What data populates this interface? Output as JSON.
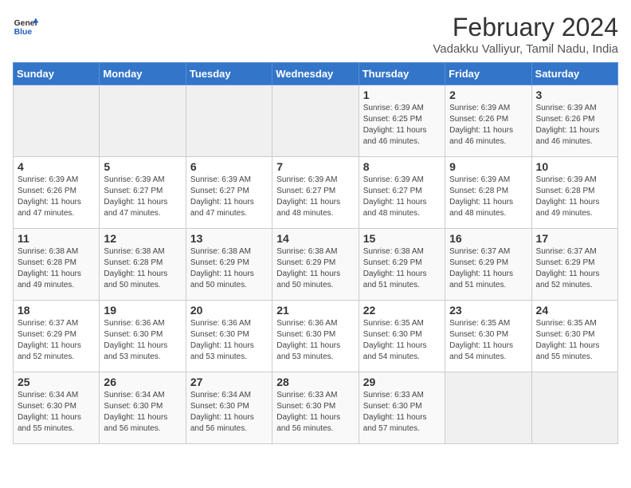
{
  "logo": {
    "line1": "General",
    "line2": "Blue"
  },
  "title": "February 2024",
  "location": "Vadakku Valliyur, Tamil Nadu, India",
  "days_of_week": [
    "Sunday",
    "Monday",
    "Tuesday",
    "Wednesday",
    "Thursday",
    "Friday",
    "Saturday"
  ],
  "weeks": [
    [
      {
        "day": "",
        "info": ""
      },
      {
        "day": "",
        "info": ""
      },
      {
        "day": "",
        "info": ""
      },
      {
        "day": "",
        "info": ""
      },
      {
        "day": "1",
        "info": "Sunrise: 6:39 AM\nSunset: 6:25 PM\nDaylight: 11 hours\nand 46 minutes."
      },
      {
        "day": "2",
        "info": "Sunrise: 6:39 AM\nSunset: 6:26 PM\nDaylight: 11 hours\nand 46 minutes."
      },
      {
        "day": "3",
        "info": "Sunrise: 6:39 AM\nSunset: 6:26 PM\nDaylight: 11 hours\nand 46 minutes."
      }
    ],
    [
      {
        "day": "4",
        "info": "Sunrise: 6:39 AM\nSunset: 6:26 PM\nDaylight: 11 hours\nand 47 minutes."
      },
      {
        "day": "5",
        "info": "Sunrise: 6:39 AM\nSunset: 6:27 PM\nDaylight: 11 hours\nand 47 minutes."
      },
      {
        "day": "6",
        "info": "Sunrise: 6:39 AM\nSunset: 6:27 PM\nDaylight: 11 hours\nand 47 minutes."
      },
      {
        "day": "7",
        "info": "Sunrise: 6:39 AM\nSunset: 6:27 PM\nDaylight: 11 hours\nand 48 minutes."
      },
      {
        "day": "8",
        "info": "Sunrise: 6:39 AM\nSunset: 6:27 PM\nDaylight: 11 hours\nand 48 minutes."
      },
      {
        "day": "9",
        "info": "Sunrise: 6:39 AM\nSunset: 6:28 PM\nDaylight: 11 hours\nand 48 minutes."
      },
      {
        "day": "10",
        "info": "Sunrise: 6:39 AM\nSunset: 6:28 PM\nDaylight: 11 hours\nand 49 minutes."
      }
    ],
    [
      {
        "day": "11",
        "info": "Sunrise: 6:38 AM\nSunset: 6:28 PM\nDaylight: 11 hours\nand 49 minutes."
      },
      {
        "day": "12",
        "info": "Sunrise: 6:38 AM\nSunset: 6:28 PM\nDaylight: 11 hours\nand 50 minutes."
      },
      {
        "day": "13",
        "info": "Sunrise: 6:38 AM\nSunset: 6:29 PM\nDaylight: 11 hours\nand 50 minutes."
      },
      {
        "day": "14",
        "info": "Sunrise: 6:38 AM\nSunset: 6:29 PM\nDaylight: 11 hours\nand 50 minutes."
      },
      {
        "day": "15",
        "info": "Sunrise: 6:38 AM\nSunset: 6:29 PM\nDaylight: 11 hours\nand 51 minutes."
      },
      {
        "day": "16",
        "info": "Sunrise: 6:37 AM\nSunset: 6:29 PM\nDaylight: 11 hours\nand 51 minutes."
      },
      {
        "day": "17",
        "info": "Sunrise: 6:37 AM\nSunset: 6:29 PM\nDaylight: 11 hours\nand 52 minutes."
      }
    ],
    [
      {
        "day": "18",
        "info": "Sunrise: 6:37 AM\nSunset: 6:29 PM\nDaylight: 11 hours\nand 52 minutes."
      },
      {
        "day": "19",
        "info": "Sunrise: 6:36 AM\nSunset: 6:30 PM\nDaylight: 11 hours\nand 53 minutes."
      },
      {
        "day": "20",
        "info": "Sunrise: 6:36 AM\nSunset: 6:30 PM\nDaylight: 11 hours\nand 53 minutes."
      },
      {
        "day": "21",
        "info": "Sunrise: 6:36 AM\nSunset: 6:30 PM\nDaylight: 11 hours\nand 53 minutes."
      },
      {
        "day": "22",
        "info": "Sunrise: 6:35 AM\nSunset: 6:30 PM\nDaylight: 11 hours\nand 54 minutes."
      },
      {
        "day": "23",
        "info": "Sunrise: 6:35 AM\nSunset: 6:30 PM\nDaylight: 11 hours\nand 54 minutes."
      },
      {
        "day": "24",
        "info": "Sunrise: 6:35 AM\nSunset: 6:30 PM\nDaylight: 11 hours\nand 55 minutes."
      }
    ],
    [
      {
        "day": "25",
        "info": "Sunrise: 6:34 AM\nSunset: 6:30 PM\nDaylight: 11 hours\nand 55 minutes."
      },
      {
        "day": "26",
        "info": "Sunrise: 6:34 AM\nSunset: 6:30 PM\nDaylight: 11 hours\nand 56 minutes."
      },
      {
        "day": "27",
        "info": "Sunrise: 6:34 AM\nSunset: 6:30 PM\nDaylight: 11 hours\nand 56 minutes."
      },
      {
        "day": "28",
        "info": "Sunrise: 6:33 AM\nSunset: 6:30 PM\nDaylight: 11 hours\nand 56 minutes."
      },
      {
        "day": "29",
        "info": "Sunrise: 6:33 AM\nSunset: 6:30 PM\nDaylight: 11 hours\nand 57 minutes."
      },
      {
        "day": "",
        "info": ""
      },
      {
        "day": "",
        "info": ""
      }
    ]
  ]
}
